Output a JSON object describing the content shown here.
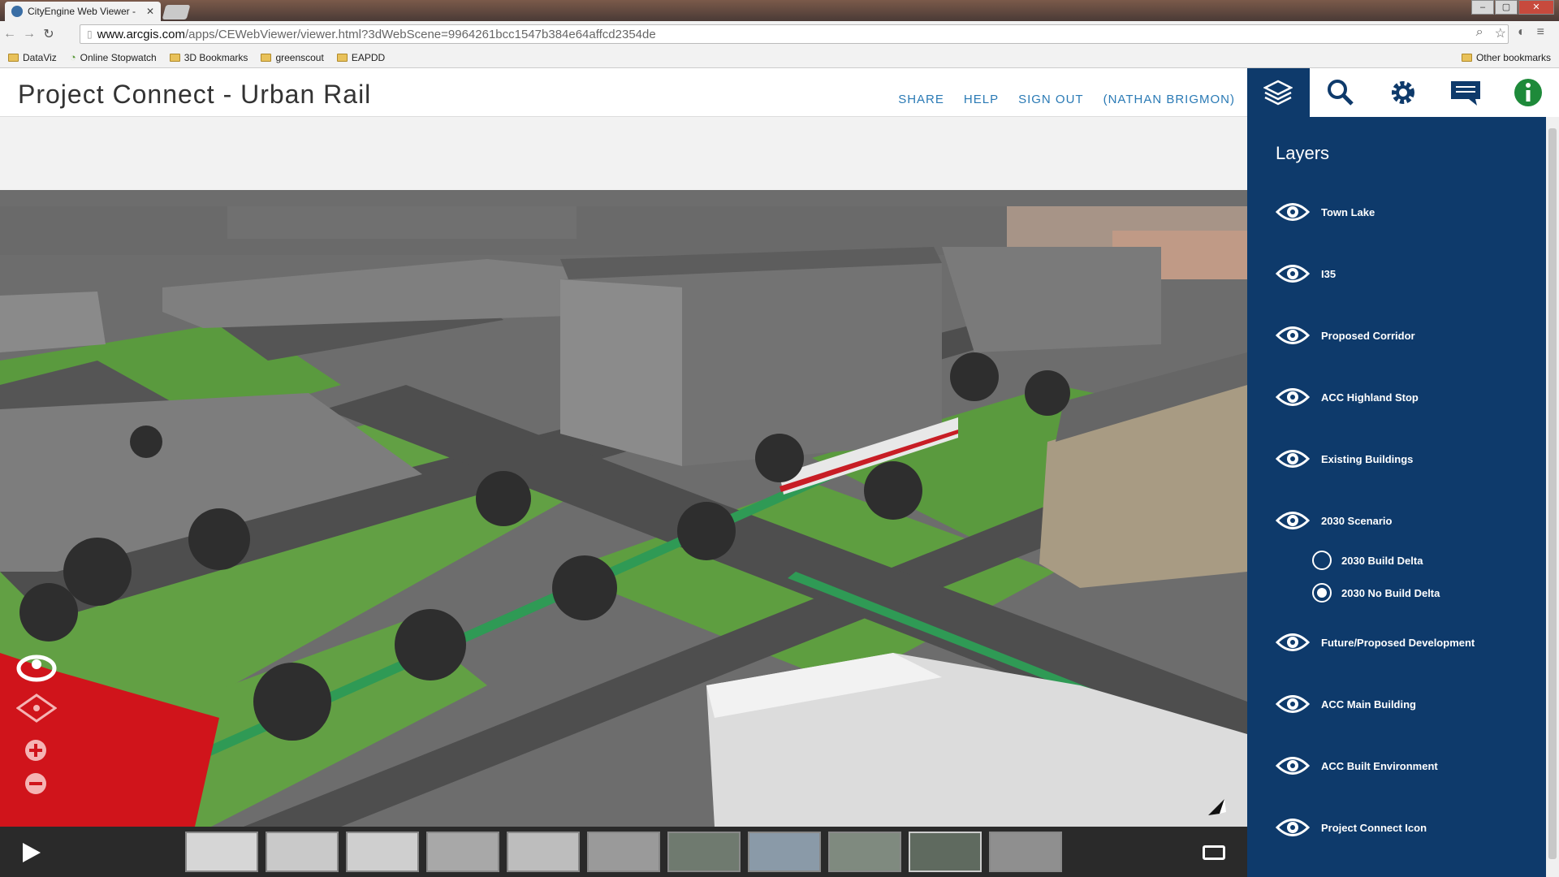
{
  "browser": {
    "tab_title": "CityEngine Web Viewer - ",
    "url_host": "www.arcgis.com",
    "url_path": "/apps/CEWebViewer/viewer.html?3dWebScene=9964261bcc1547b384e64affcd2354de",
    "bookmarks": [
      "DataViz",
      "Online Stopwatch",
      "3D Bookmarks",
      "greenscout",
      "EAPDD"
    ],
    "other_bookmarks": "Other bookmarks"
  },
  "app": {
    "title": "Project Connect - Urban Rail",
    "links": {
      "share": "SHARE",
      "help": "HELP",
      "signout": "SIGN OUT",
      "user": "(NATHAN BRIGMON)"
    }
  },
  "sidebar": {
    "title": "Layers",
    "layers": [
      "Town Lake",
      "I35",
      "Proposed Corridor",
      "ACC Highland Stop",
      "Existing Buildings",
      "2030 Scenario",
      "Future/Proposed Development",
      "ACC Main Building",
      "ACC Built Environment",
      "Project Connect Icon"
    ],
    "scenario_options": [
      "2030 Build Delta",
      "2030 No Build Delta"
    ],
    "scenario_selected": "2030 No Build Delta"
  },
  "colors": {
    "sidebar_bg": "#0e3a6b",
    "link_blue": "#2a7ab5",
    "nav_red": "#d0141b"
  },
  "icons": [
    "layers-icon",
    "search-icon",
    "gear-icon",
    "comment-icon",
    "info-icon",
    "eye-icon",
    "play-icon",
    "fullscreen-icon",
    "zoom-in-icon",
    "zoom-out-icon",
    "orbit-icon",
    "pan-icon",
    "north-arrow-icon"
  ]
}
